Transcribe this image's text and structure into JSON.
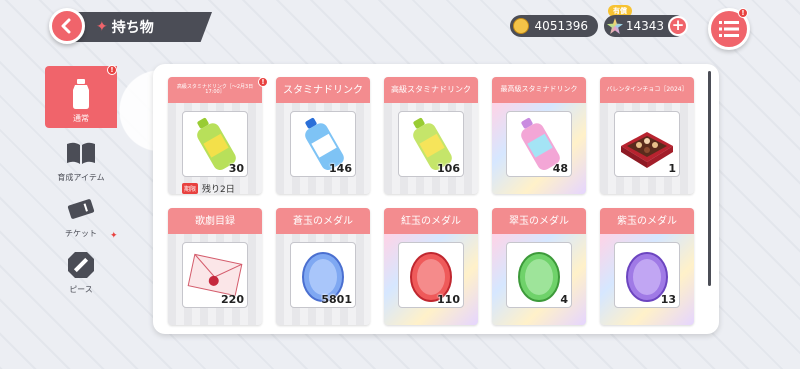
{
  "header": {
    "title": "持ち物",
    "coins": "4051396",
    "paid_badge": "有償",
    "stars": "14343",
    "plus": "+",
    "menu_alert": "!"
  },
  "sidebar": {
    "items": [
      {
        "label": "通常",
        "alert": "!"
      },
      {
        "label": "育成アイテム"
      },
      {
        "label": "チケット"
      },
      {
        "label": "ピース"
      }
    ]
  },
  "items": [
    {
      "name": "高級スタミナドリンク［～2月3日 17:00］",
      "qty": "30",
      "alert": "!",
      "limit_tag": "期限",
      "limit_text": "残り2日",
      "icon": "drink-green-icon"
    },
    {
      "name": "スタミナドリンク",
      "qty": "146",
      "icon": "drink-blue-icon"
    },
    {
      "name": "高級スタミナドリンク",
      "qty": "106",
      "icon": "drink-green-icon"
    },
    {
      "name": "最高級スタミナドリンク",
      "qty": "48",
      "icon": "drink-pink-icon"
    },
    {
      "name": "バレンタインチョコ［2024］",
      "qty": "1",
      "icon": "chocolate-box-icon"
    },
    {
      "name": "歌劇目録",
      "qty": "220",
      "icon": "catalog-letter-icon"
    },
    {
      "name": "蒼玉のメダル",
      "qty": "5801",
      "icon": "blue-medal-icon"
    },
    {
      "name": "紅玉のメダル",
      "qty": "110",
      "icon": "red-medal-icon"
    },
    {
      "name": "翠玉のメダル",
      "qty": "4",
      "icon": "green-medal-icon"
    },
    {
      "name": "紫玉のメダル",
      "qty": "13",
      "icon": "purple-medal-icon"
    }
  ],
  "colors": {
    "accent": "#f0646b",
    "dark": "#4b4d56",
    "card_header": "#f38c8f"
  }
}
